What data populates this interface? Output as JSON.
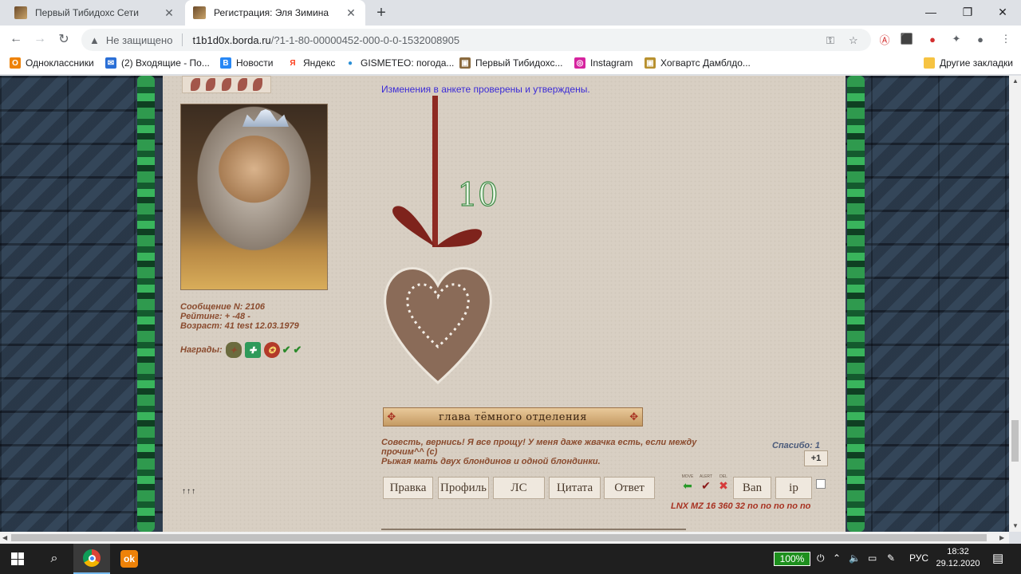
{
  "browser": {
    "tabs": [
      {
        "title": "Первый Тибидохс Сети",
        "active": false
      },
      {
        "title": "Регистрация: Эля Зимина",
        "active": true
      }
    ],
    "new_tab": "+",
    "window": {
      "minimize": "—",
      "maximize": "❐",
      "close": "✕"
    },
    "nav": {
      "back": "←",
      "forward": "→",
      "reload": "↻"
    },
    "address": {
      "security": "Не защищено",
      "host": "t1b1d0x.borda.ru",
      "path": "/?1-1-80-00000452-000-0-0-1532008905"
    }
  },
  "bookmarks": [
    {
      "label": "Одноклассники",
      "color": "#ee8208",
      "glyph": "О"
    },
    {
      "label": "(2) Входящие - По...",
      "color": "#2a6fd6",
      "glyph": "✉"
    },
    {
      "label": "Новости",
      "color": "#2787f5",
      "glyph": "В"
    },
    {
      "label": "Яндекс",
      "color": "#fc3f1d",
      "glyph": "Я"
    },
    {
      "label": "GISMETEO: погода...",
      "color": "#2b8fd6",
      "glyph": "●"
    },
    {
      "label": "Первый Тибидохс...",
      "color": "#8a6a3e",
      "glyph": "▣"
    },
    {
      "label": "Instagram",
      "color": "#d6249f",
      "glyph": "◎"
    },
    {
      "label": "Хогвартс Дамблдо...",
      "color": "#b8912f",
      "glyph": "▣"
    }
  ],
  "other_bookmarks": "Другие закладки",
  "post": {
    "status": "Изменения в анкете проверены и утверждены.",
    "ornament_number": "10",
    "signature_banner": "глава тёмного отделения",
    "signature_lines": [
      "Совесть, вернись! Я все прощу! У меня даже жвачка есть, если между",
      "прочим^^ (с)",
      "Рыжая мать двух блондинов и одной блондинки."
    ],
    "thanks": "Спасибо: 1",
    "plus_one": "+1",
    "buttons": [
      "Правка",
      "Профиль",
      "ЛС",
      "Цитата",
      "Ответ"
    ],
    "mod_labels": [
      "MOVE",
      "ALERT",
      "DEL"
    ],
    "ban": "Ban",
    "ip": "ip",
    "lnx": "LNX MZ 16 360 32 no no no no no"
  },
  "user": {
    "message_no": "Сообщение N: 2106",
    "rating": "Рейтинг: + -48 -",
    "age": "Возраст: 41 test 12.03.1979",
    "awards_label": "Награды:"
  },
  "footer_dots": "↑↑↑",
  "taskbar": {
    "battery": "100%",
    "lang": "РУС",
    "time": "18:32",
    "date": "29.12.2020"
  }
}
